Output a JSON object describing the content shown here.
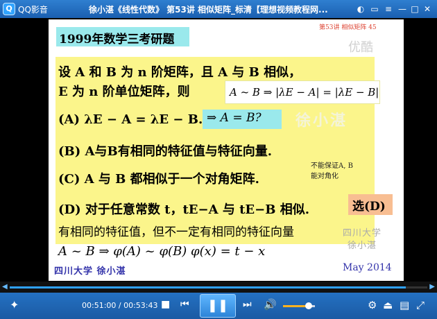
{
  "window": {
    "app_name": "QQ影音",
    "title": "徐小湛《线性代数》 第53讲 相似矩阵_标清【理想视频教程网...",
    "logo_glyph": "Q"
  },
  "slide": {
    "page_header": "第53讲 相似矩阵 45",
    "youku": "优酷",
    "exam_title": "1999年数学三考研题",
    "question_line1": "设 A 和 B 为 n 阶矩阵，且 A 与 B 相似，",
    "question_line2": "E 为 n 阶单位矩阵，则",
    "conclusion": "A ~ B ⇒ |λE − A| = |λE − B|",
    "option_a": "(A) λE − A = λE − B.",
    "option_a_box": "⇒ A = B?",
    "watermark": "徐小湛",
    "option_b": "(B) A与B有相同的特征值与特征向量.",
    "option_c": "(C) A 与 B 都相似于一个对角矩阵.",
    "note_line1": "不能保证A, B",
    "note_line2": "能对角化",
    "option_d": "(D) 对于任意常数 t，tE−A 与 tE−B 相似.",
    "answer": "选(D)",
    "bottom_text": "有相同的特征值，但不一定有相同的特征向量",
    "formula": "A ~ B ⇒ φ(A) ~ φ(B)     φ(x) = t − x",
    "univ_right_1": "四川大学",
    "univ_right_2": "徐小湛",
    "footer_left": "四川大学   徐小湛",
    "footer_right": "May 2014"
  },
  "player": {
    "current_time": "00:51:00",
    "total_time": "00:53:43",
    "time_display": "00:51:00 / 00:53:43",
    "progress_fraction": 0.949,
    "volume_fraction": 0.8
  },
  "icons": {
    "skin": "◐",
    "minimize": "—",
    "maximize": "□",
    "close": "✕",
    "menu": "≡",
    "tool": "▭",
    "seek_left": "◀",
    "seek_right": "▶",
    "stop": "■",
    "prev": "⏮",
    "play_pause": "❚❚",
    "next": "⏭",
    "volume": "🔊",
    "settings": "⚙",
    "eject": "⏏",
    "playlist": "▤",
    "fullscreen": "⤢",
    "accessibility": "✦"
  },
  "colors": {
    "accent": "#2fa2ff",
    "volume": "#ffb21f",
    "slide_cyan": "#9ae9ec",
    "slide_yellow": "#fbf58b",
    "answer_orange": "#f8be92"
  }
}
